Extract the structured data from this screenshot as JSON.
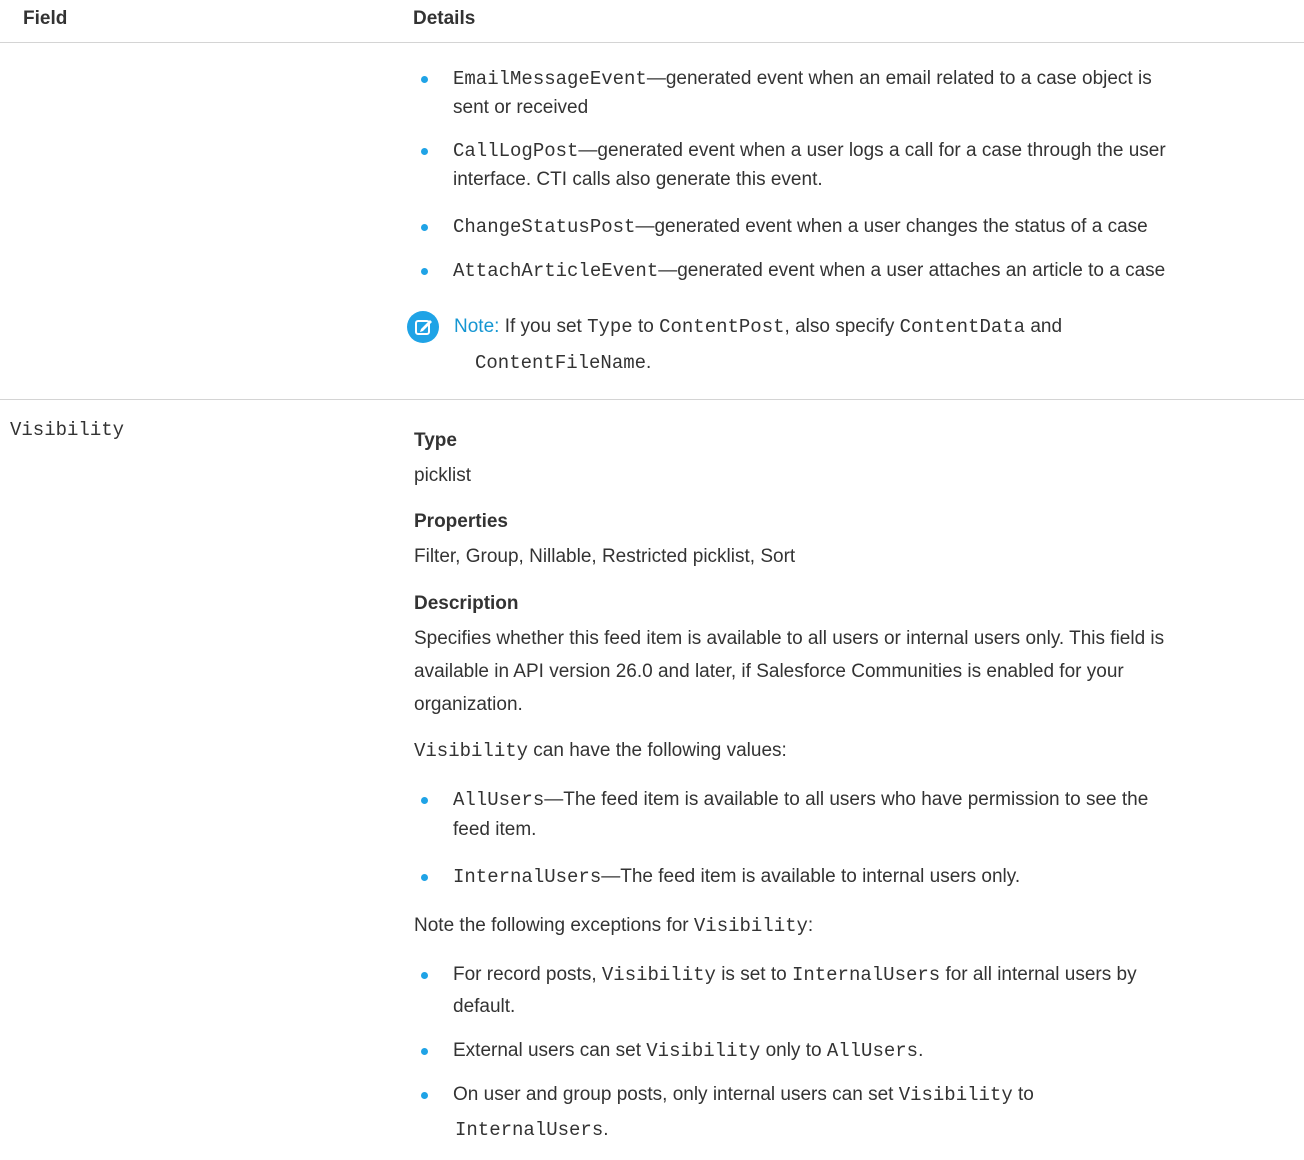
{
  "table": {
    "header_field": "Field",
    "header_details": "Details"
  },
  "top_bullets": [
    {
      "code": "EmailMessageEvent",
      "text_line1": "—generated event when an email related to a case object is",
      "text_line2": "sent or received"
    },
    {
      "code": "CallLogPost",
      "text_line1": "—generated event when a user logs a call for a case through the user",
      "text_line2": "interface. CTI calls also generate this event."
    },
    {
      "code": "ChangeStatusPost",
      "text_line1": "—generated event when a user changes the status of a case"
    },
    {
      "code": "AttachArticleEvent",
      "text_line1": "—generated event when a user attaches an article to a case"
    }
  ],
  "note": {
    "icon": "edit-icon",
    "label": "Note:",
    "t1": " If you set ",
    "c1": "Type",
    "t2": " to ",
    "c2": "ContentPost",
    "t3": ", also specify ",
    "c3": "ContentData",
    "t4": " and",
    "c4": "ContentFileName",
    "t5": "."
  },
  "visibility": {
    "field_name": "Visibility",
    "type_label": "Type",
    "type_value": "picklist",
    "properties_label": "Properties",
    "properties_value": "Filter, Group, Nillable, Restricted picklist, Sort",
    "description_label": "Description",
    "description_lines": [
      "Specifies whether this feed item is available to all users or internal users only. This field is",
      "available in API version 26.0 and later, if Salesforce Communities is enabled for your",
      "organization."
    ],
    "values_intro_code": "Visibility",
    "values_intro_text": " can have the following values:",
    "values": [
      {
        "code": "AllUsers",
        "text_line1": "—The feed item is available to all users who have permission to see the",
        "text_line2": "feed item."
      },
      {
        "code": "InternalUsers",
        "text_line1": "—The feed item is available to internal users only."
      }
    ],
    "exceptions_intro_text": "Note the following exceptions for ",
    "exceptions_intro_code": "Visibility",
    "exceptions_intro_end": ":",
    "exceptions": {
      "e1_t1": "For record posts, ",
      "e1_c1": "Visibility",
      "e1_t2": " is set to ",
      "e1_c2": "InternalUsers",
      "e1_t3": " for all internal users by",
      "e1_line2": "default.",
      "e2_t1": "External users can set ",
      "e2_c1": "Visibility",
      "e2_t2": " only to ",
      "e2_c2": "AllUsers",
      "e2_t3": ".",
      "e3_t1": "On user and group posts, only internal users can set ",
      "e3_c1": "Visibility",
      "e3_t2": " to",
      "e3_c2": "InternalUsers",
      "e3_t3": "."
    }
  },
  "colors": {
    "accent": "#1fa3e6",
    "rule": "#d4d4d4",
    "text": "#333333"
  }
}
